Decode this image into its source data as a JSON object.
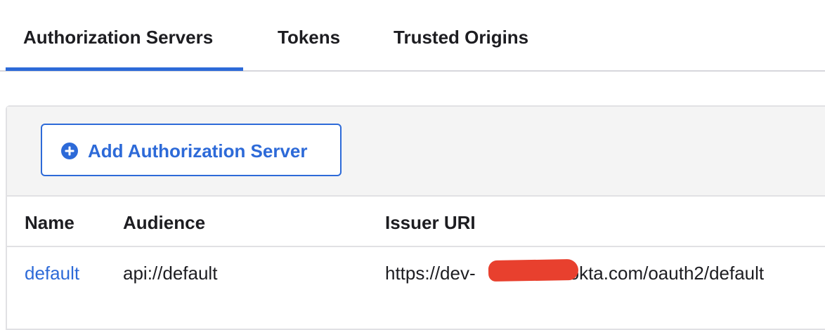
{
  "tabs": [
    {
      "label": "Authorization Servers",
      "active": true
    },
    {
      "label": "Tokens",
      "active": false
    },
    {
      "label": "Trusted Origins",
      "active": false
    }
  ],
  "toolbar": {
    "add_button_label": "Add Authorization Server",
    "add_button_icon": "plus-circle-icon"
  },
  "table": {
    "columns": [
      "Name",
      "Audience",
      "Issuer URI"
    ],
    "rows": [
      {
        "name": "default",
        "audience": "api://default",
        "issuer_uri_prefix": "https://dev-",
        "issuer_uri_suffix": "okta.com/oauth2/default"
      }
    ]
  },
  "colors": {
    "accent": "#2d6ad8",
    "text": "#1d1d21",
    "toolbar_bg": "#f4f4f4",
    "redaction": "#e8402e"
  }
}
